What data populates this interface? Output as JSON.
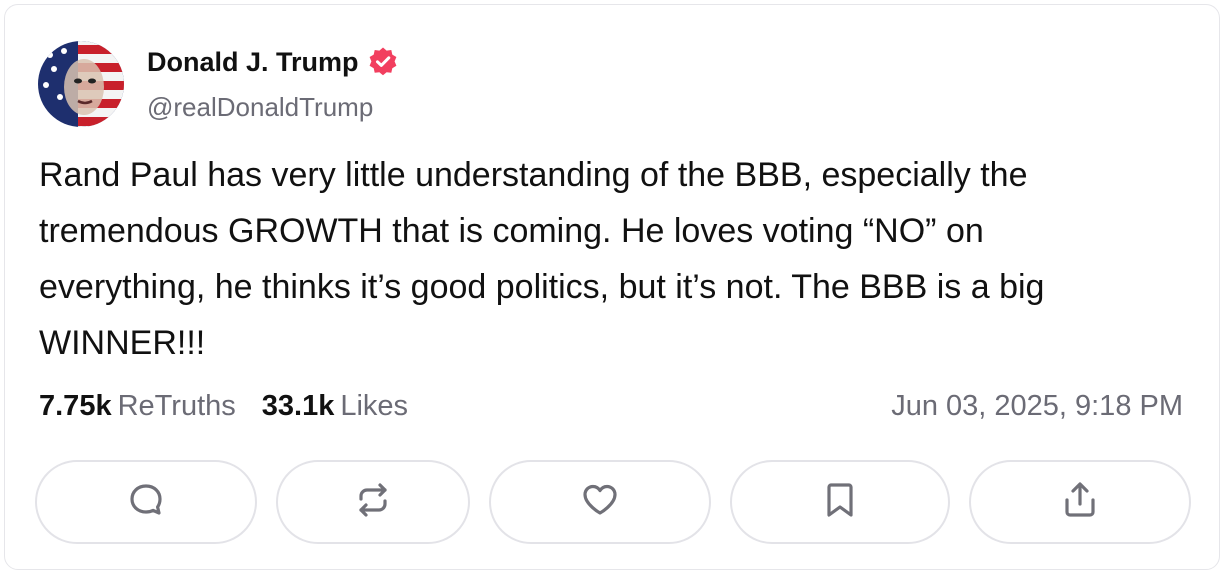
{
  "post": {
    "author": {
      "display_name": "Donald J. Trump",
      "handle": "@realDonaldTrump",
      "verified": true
    },
    "text": "Rand Paul has very little understanding of the BBB, especially the\ntremendous GROWTH that is coming. He loves voting “NO” on\neverything, he thinks it’s good politics, but it’s not. The BBB is a big\nWINNER!!!",
    "stats": {
      "retruths_count": "7.75k",
      "retruths_label": "ReTruths",
      "likes_count": "33.1k",
      "likes_label": "Likes"
    },
    "timestamp": "Jun 03, 2025, 9:18 PM"
  },
  "actions": [
    {
      "name": "reply",
      "icon": "reply-icon"
    },
    {
      "name": "retruth",
      "icon": "retruth-icon"
    },
    {
      "name": "like",
      "icon": "heart-icon"
    },
    {
      "name": "bookmark",
      "icon": "bookmark-icon"
    },
    {
      "name": "share",
      "icon": "share-icon"
    }
  ],
  "colors": {
    "verified_badge": "#f23f5f",
    "muted_text": "#6b6b75",
    "border": "#e3e3e8",
    "icon": "#707078"
  }
}
